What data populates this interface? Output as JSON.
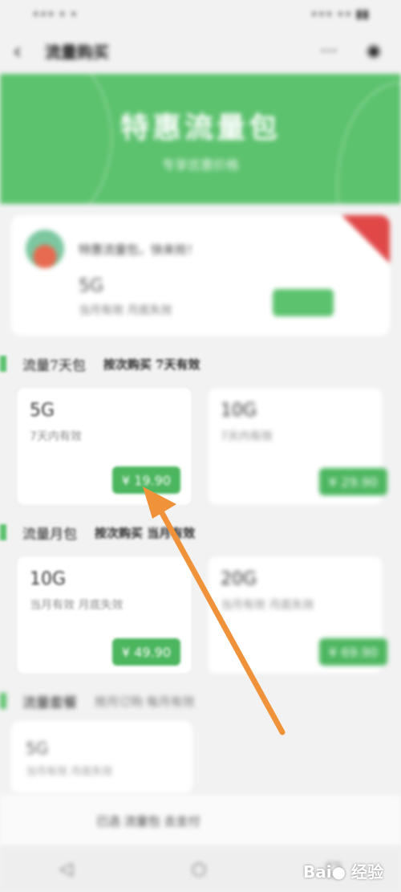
{
  "statusbar": {
    "left": "∙∙∙ ∙ ∙",
    "right": "∙∙∙ ∙∙ ▮▮"
  },
  "appbar": {
    "back": "‹",
    "title": "流量购买"
  },
  "banner": {
    "title": "特惠流量包",
    "subtitle": "专享优惠价格"
  },
  "top_card": {
    "text": "特惠流量包，快来抢！",
    "size": "5G",
    "validity": "当月有效  月底失效"
  },
  "sections": [
    {
      "name": "流量7天包",
      "desc": "按次购买 7天有效",
      "items": [
        {
          "size": "5G",
          "validity": "7天内有效",
          "price": "¥ 19.90"
        },
        {
          "size": "10G",
          "validity": "7天内有效",
          "price": "¥ 29.90"
        }
      ]
    },
    {
      "name": "流量月包",
      "desc": "按次购买 当月有效",
      "items": [
        {
          "size": "10G",
          "validity": "当月有效 月底失效",
          "price": "¥ 49.90"
        },
        {
          "size": "20G",
          "validity": "当月有效 月底失效",
          "price": "¥ 69.90"
        }
      ]
    },
    {
      "name": "流量套餐",
      "desc": "按月订购 每月有效"
    }
  ],
  "bottom_card": {
    "size": "5G",
    "validity": "当月有效 月底失效"
  },
  "footer": {
    "text": "已选 流量包 去支付"
  },
  "navbar": {
    "back": "◁",
    "home": "○",
    "recent": "□"
  },
  "watermark": "Bai● 经验",
  "colors": {
    "accent": "#5cc26e",
    "price_button": "#4cb65f",
    "arrow": "#f0923a",
    "corner": "#e04848"
  }
}
